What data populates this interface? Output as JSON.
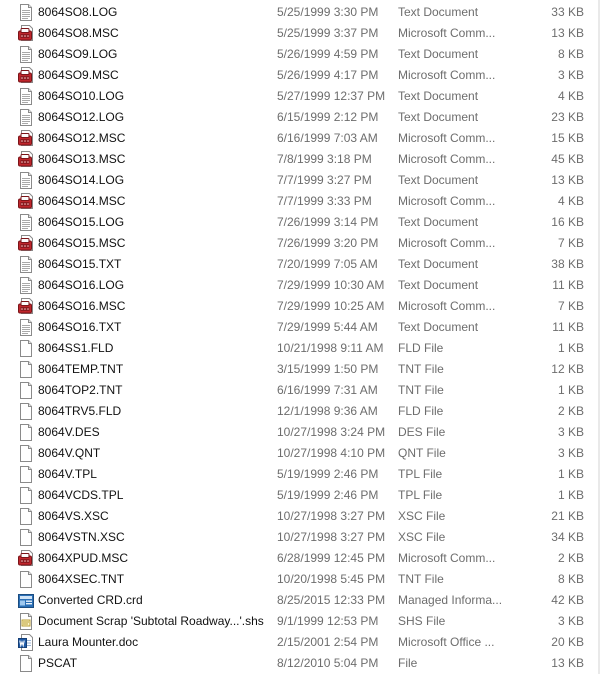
{
  "files": [
    {
      "name": "8064SO8.LOG",
      "date": "5/25/1999 3:30 PM",
      "type": "Text Document",
      "size": "33 KB",
      "icon": "text-document-icon"
    },
    {
      "name": "8064SO8.MSC",
      "date": "5/25/1999 3:37 PM",
      "type": "Microsoft Comm...",
      "size": "13 KB",
      "icon": "msc-document-icon"
    },
    {
      "name": "8064SO9.LOG",
      "date": "5/26/1999 4:59 PM",
      "type": "Text Document",
      "size": "8 KB",
      "icon": "text-document-icon"
    },
    {
      "name": "8064SO9.MSC",
      "date": "5/26/1999 4:17 PM",
      "type": "Microsoft Comm...",
      "size": "3 KB",
      "icon": "msc-document-icon"
    },
    {
      "name": "8064SO10.LOG",
      "date": "5/27/1999 12:37 PM",
      "type": "Text Document",
      "size": "4 KB",
      "icon": "text-document-icon"
    },
    {
      "name": "8064SO12.LOG",
      "date": "6/15/1999 2:12 PM",
      "type": "Text Document",
      "size": "23 KB",
      "icon": "text-document-icon"
    },
    {
      "name": "8064SO12.MSC",
      "date": "6/16/1999 7:03 AM",
      "type": "Microsoft Comm...",
      "size": "15 KB",
      "icon": "msc-document-icon"
    },
    {
      "name": "8064SO13.MSC",
      "date": "7/8/1999 3:18 PM",
      "type": "Microsoft Comm...",
      "size": "45 KB",
      "icon": "msc-document-icon"
    },
    {
      "name": "8064SO14.LOG",
      "date": "7/7/1999 3:27 PM",
      "type": "Text Document",
      "size": "13 KB",
      "icon": "text-document-icon"
    },
    {
      "name": "8064SO14.MSC",
      "date": "7/7/1999 3:33 PM",
      "type": "Microsoft Comm...",
      "size": "4 KB",
      "icon": "msc-document-icon"
    },
    {
      "name": "8064SO15.LOG",
      "date": "7/26/1999 3:14 PM",
      "type": "Text Document",
      "size": "16 KB",
      "icon": "text-document-icon"
    },
    {
      "name": "8064SO15.MSC",
      "date": "7/26/1999 3:20 PM",
      "type": "Microsoft Comm...",
      "size": "7 KB",
      "icon": "msc-document-icon"
    },
    {
      "name": "8064SO15.TXT",
      "date": "7/20/1999 7:05 AM",
      "type": "Text Document",
      "size": "38 KB",
      "icon": "text-document-icon"
    },
    {
      "name": "8064SO16.LOG",
      "date": "7/29/1999 10:30 AM",
      "type": "Text Document",
      "size": "11 KB",
      "icon": "text-document-icon"
    },
    {
      "name": "8064SO16.MSC",
      "date": "7/29/1999 10:25 AM",
      "type": "Microsoft Comm...",
      "size": "7 KB",
      "icon": "msc-document-icon"
    },
    {
      "name": "8064SO16.TXT",
      "date": "7/29/1999 5:44 AM",
      "type": "Text Document",
      "size": "11 KB",
      "icon": "text-document-icon"
    },
    {
      "name": "8064SS1.FLD",
      "date": "10/21/1998 9:11 AM",
      "type": "FLD File",
      "size": "1 KB",
      "icon": "blank-file-icon"
    },
    {
      "name": "8064TEMP.TNT",
      "date": "3/15/1999 1:50 PM",
      "type": "TNT File",
      "size": "12 KB",
      "icon": "blank-file-icon"
    },
    {
      "name": "8064TOP2.TNT",
      "date": "6/16/1999 7:31 AM",
      "type": "TNT File",
      "size": "1 KB",
      "icon": "blank-file-icon"
    },
    {
      "name": "8064TRV5.FLD",
      "date": "12/1/1998 9:36 AM",
      "type": "FLD File",
      "size": "2 KB",
      "icon": "blank-file-icon"
    },
    {
      "name": "8064V.DES",
      "date": "10/27/1998 3:24 PM",
      "type": "DES File",
      "size": "3 KB",
      "icon": "blank-file-icon"
    },
    {
      "name": "8064V.QNT",
      "date": "10/27/1998 4:10 PM",
      "type": "QNT File",
      "size": "3 KB",
      "icon": "blank-file-icon"
    },
    {
      "name": "8064V.TPL",
      "date": "5/19/1999 2:46 PM",
      "type": "TPL File",
      "size": "1 KB",
      "icon": "blank-file-icon"
    },
    {
      "name": "8064VCDS.TPL",
      "date": "5/19/1999 2:46 PM",
      "type": "TPL File",
      "size": "1 KB",
      "icon": "blank-file-icon"
    },
    {
      "name": "8064VS.XSC",
      "date": "10/27/1998 3:27 PM",
      "type": "XSC File",
      "size": "21 KB",
      "icon": "blank-file-icon"
    },
    {
      "name": "8064VSTN.XSC",
      "date": "10/27/1998 3:27 PM",
      "type": "XSC File",
      "size": "34 KB",
      "icon": "blank-file-icon"
    },
    {
      "name": "8064XPUD.MSC",
      "date": "6/28/1999 12:45 PM",
      "type": "Microsoft Comm...",
      "size": "2 KB",
      "icon": "msc-document-icon"
    },
    {
      "name": "8064XSEC.TNT",
      "date": "10/20/1998 5:45 PM",
      "type": "TNT File",
      "size": "8 KB",
      "icon": "blank-file-icon"
    },
    {
      "name": "Converted CRD.crd",
      "date": "8/25/2015 12:33 PM",
      "type": "Managed Informa...",
      "size": "42 KB",
      "icon": "crd-file-icon"
    },
    {
      "name": "Document Scrap 'Subtotal Roadway...'.shs",
      "date": "9/1/1999 12:53 PM",
      "type": "SHS File",
      "size": "3 KB",
      "icon": "scrap-file-icon"
    },
    {
      "name": "Laura Mounter.doc",
      "date": "2/15/2001 2:54 PM",
      "type": "Microsoft Office ...",
      "size": "20 KB",
      "icon": "word-document-icon"
    },
    {
      "name": "PSCAT",
      "date": "8/12/2010 5:04 PM",
      "type": "File",
      "size": "13 KB",
      "icon": "blank-file-icon"
    }
  ]
}
